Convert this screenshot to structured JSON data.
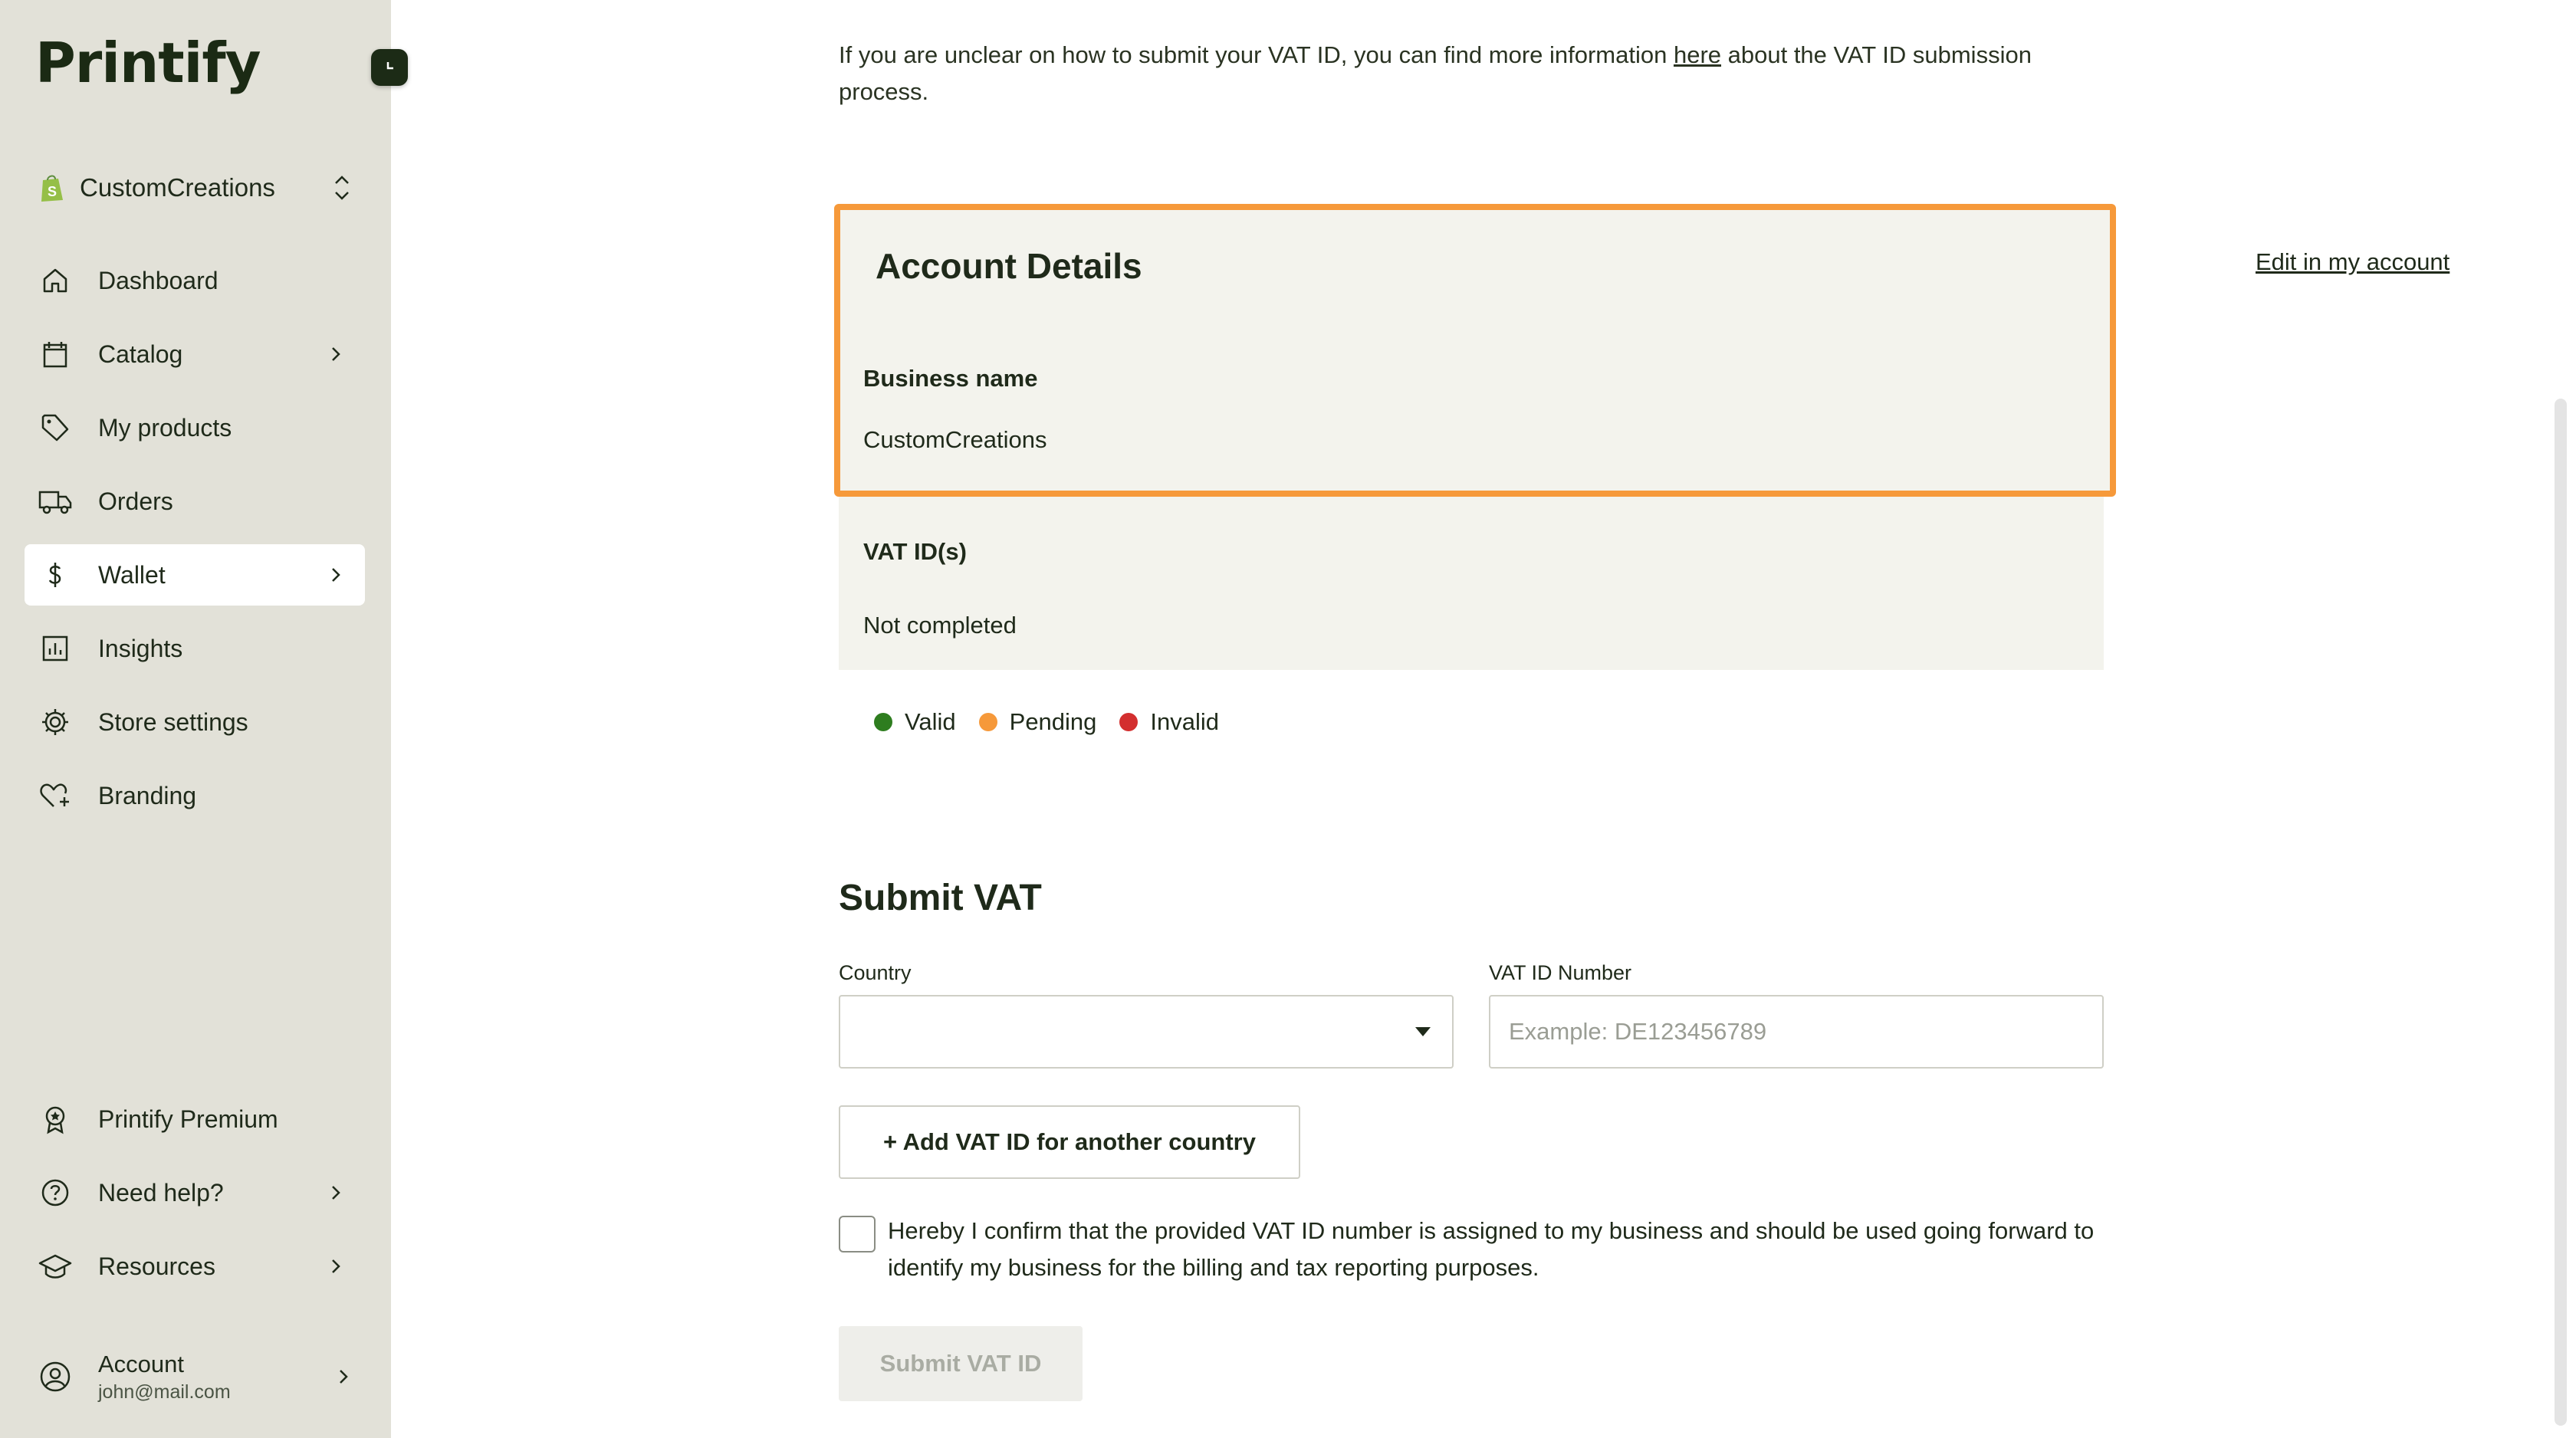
{
  "sidebar": {
    "logo": "Printify",
    "store_name": "CustomCreations",
    "nav": [
      {
        "label": "Dashboard",
        "icon": "home-icon"
      },
      {
        "label": "Catalog",
        "icon": "catalog-icon"
      },
      {
        "label": "My products",
        "icon": "tag-icon"
      },
      {
        "label": "Orders",
        "icon": "truck-icon"
      },
      {
        "label": "Wallet",
        "icon": "dollar-icon"
      },
      {
        "label": "Insights",
        "icon": "chart-icon"
      },
      {
        "label": "Store settings",
        "icon": "gear-icon"
      },
      {
        "label": "Branding",
        "icon": "heart-plus-icon"
      }
    ],
    "bottom_nav": [
      {
        "label": "Printify Premium",
        "icon": "award-icon"
      },
      {
        "label": "Need help?",
        "icon": "help-icon"
      },
      {
        "label": "Resources",
        "icon": "graduation-cap-icon"
      }
    ],
    "account": {
      "label": "Account",
      "email": "john@mail.com"
    }
  },
  "main": {
    "intro_before": "If you are unclear on how to submit your VAT ID, you can find more information ",
    "intro_link": "here",
    "intro_after": " about the VAT ID submission process.",
    "account_details": {
      "title": "Account Details",
      "edit_link": "Edit in my account",
      "business_name_label": "Business name",
      "business_name_value": "CustomCreations",
      "vat_label": "VAT ID(s)",
      "vat_value": "Not completed"
    },
    "legend": [
      {
        "label": "Valid",
        "color": "#2e7d1f"
      },
      {
        "label": "Pending",
        "color": "#f6993a"
      },
      {
        "label": "Invalid",
        "color": "#d32f2f"
      }
    ],
    "submit": {
      "title": "Submit VAT",
      "country_label": "Country",
      "country_value": "",
      "vat_number_label": "VAT ID Number",
      "vat_number_placeholder": "Example: DE123456789",
      "add_button": "+ Add VAT ID for another country",
      "confirm_text": "Hereby I confirm that the provided VAT ID number is assigned to my business and should be used going forward to identify my business for the billing and tax reporting purposes.",
      "submit_button": "Submit VAT ID"
    }
  },
  "colors": {
    "sidebar_bg": "#e2e1d8",
    "highlight": "#f6993a",
    "card_bg": "#f3f3ed"
  }
}
